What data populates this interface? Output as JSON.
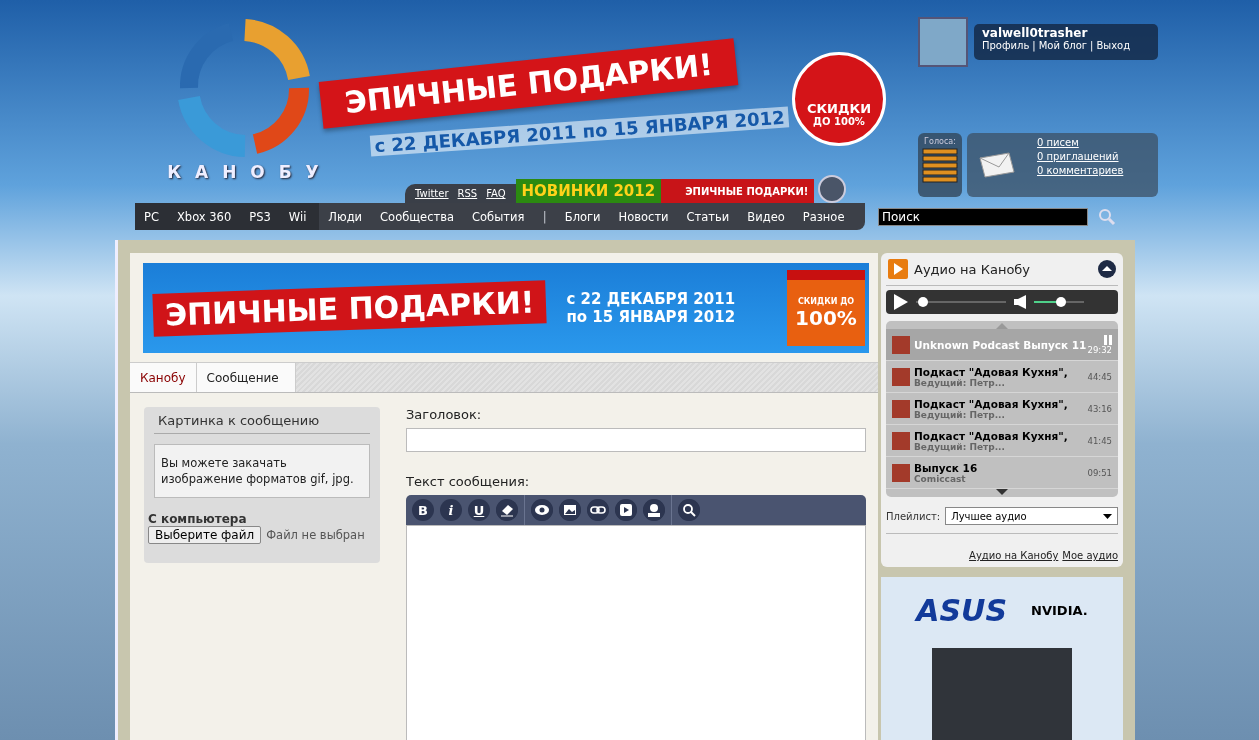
{
  "header": {
    "logo_text": "К А Н О Б У",
    "promo": {
      "title": "ЭПИЧНЫЕ ПОДАРКИ!",
      "dates": "с 22 ДЕКАБРЯ 2011 по 15 ЯНВАРЯ 2012",
      "badge_title": "СКИДКИ",
      "badge_sub": "ДО 100%"
    },
    "links": [
      "Twitter",
      "RSS",
      "FAQ"
    ],
    "promo_tabs": [
      {
        "kind": "novelty",
        "label": "НОВИНКИ 2012"
      },
      {
        "kind": "gifts",
        "label": "ЭПИЧНЫЕ ПОДАРКИ!"
      }
    ]
  },
  "user": {
    "name": "valwell0trasher",
    "separator": "|",
    "links": [
      "Профиль",
      "Мой блог",
      "Выход"
    ]
  },
  "votes": {
    "label": "Голоса:"
  },
  "messages": [
    "0 писем",
    "0 приглашений",
    "0 комментариев"
  ],
  "search": {
    "placeholder": "Поиск"
  },
  "nav": {
    "platforms": [
      "PC",
      "Xbox 360",
      "PS3",
      "Wii"
    ],
    "sections": [
      {
        "kind": "link",
        "label": "Люди"
      },
      {
        "kind": "link",
        "label": "Сообщества"
      },
      {
        "kind": "link",
        "label": "События"
      },
      {
        "kind": "divider",
        "label": "|"
      },
      {
        "kind": "link",
        "label": "Блоги"
      },
      {
        "kind": "link",
        "label": "Новости"
      },
      {
        "kind": "link",
        "label": "Статьи"
      },
      {
        "kind": "link",
        "label": "Видео"
      },
      {
        "kind": "link",
        "label": "Разное"
      }
    ]
  },
  "banner": {
    "title": "ЭПИЧНЫЕ ПОДАРКИ!",
    "date_from": "с 22 ДЕКАБРЯ 2011",
    "date_to": "по 15 ЯНВАРЯ 2012",
    "badge_title": "СКИДКИ ДО",
    "badge_value": "100%"
  },
  "breadcrumbs": [
    "Канобу",
    "Сообщение"
  ],
  "picture_panel": {
    "title": "Картинка к сообщению",
    "hint": "Вы можете закачать изображение форматов gif, jpg.",
    "source_label": "С компьютера",
    "file_button": "Выберите файл",
    "file_status": "Файл не выбран"
  },
  "form": {
    "title_label": "Заголовок:",
    "body_label": "Текст сообщения:"
  },
  "toolbar": [
    {
      "kind": "bold",
      "glyph": "B"
    },
    {
      "kind": "italic",
      "glyph": "i"
    },
    {
      "kind": "underline",
      "glyph": "U"
    },
    {
      "kind": "eraser"
    },
    {
      "kind": "divider"
    },
    {
      "kind": "eye"
    },
    {
      "kind": "image"
    },
    {
      "kind": "link"
    },
    {
      "kind": "video"
    },
    {
      "kind": "user"
    },
    {
      "kind": "divider"
    },
    {
      "kind": "search"
    }
  ],
  "audio": {
    "title": "Аудио на Канобу",
    "progress": {
      "level": 0.03
    },
    "volume": {
      "level": 0.55
    },
    "tracks": [
      {
        "title": "Unknown Podcast Выпуск 11",
        "duration": "29:32",
        "selected": true
      },
      {
        "title": "Подкаст \"Адовая Кухня\",",
        "subtitle": "Ведущий: Петр...",
        "duration": "44:45",
        "selected": false
      },
      {
        "title": "Подкаст \"Адовая Кухня\",",
        "subtitle": "Ведущий: Петр...",
        "duration": "43:16",
        "selected": false
      },
      {
        "title": "Подкаст \"Адовая Кухня\",",
        "subtitle": "Ведущий: Петр...",
        "duration": "41:45",
        "selected": false
      },
      {
        "title": "Выпуск 16",
        "subtitle": "Comiccast",
        "duration": "09:51",
        "selected": false
      }
    ],
    "playlist": {
      "label": "Плейлист:",
      "value": "Лучшее аудио"
    },
    "links": [
      "Аудио на Канобу",
      "Мое аудио"
    ]
  },
  "ad": {
    "brand": "ASUS",
    "partner": "NVIDIA."
  }
}
